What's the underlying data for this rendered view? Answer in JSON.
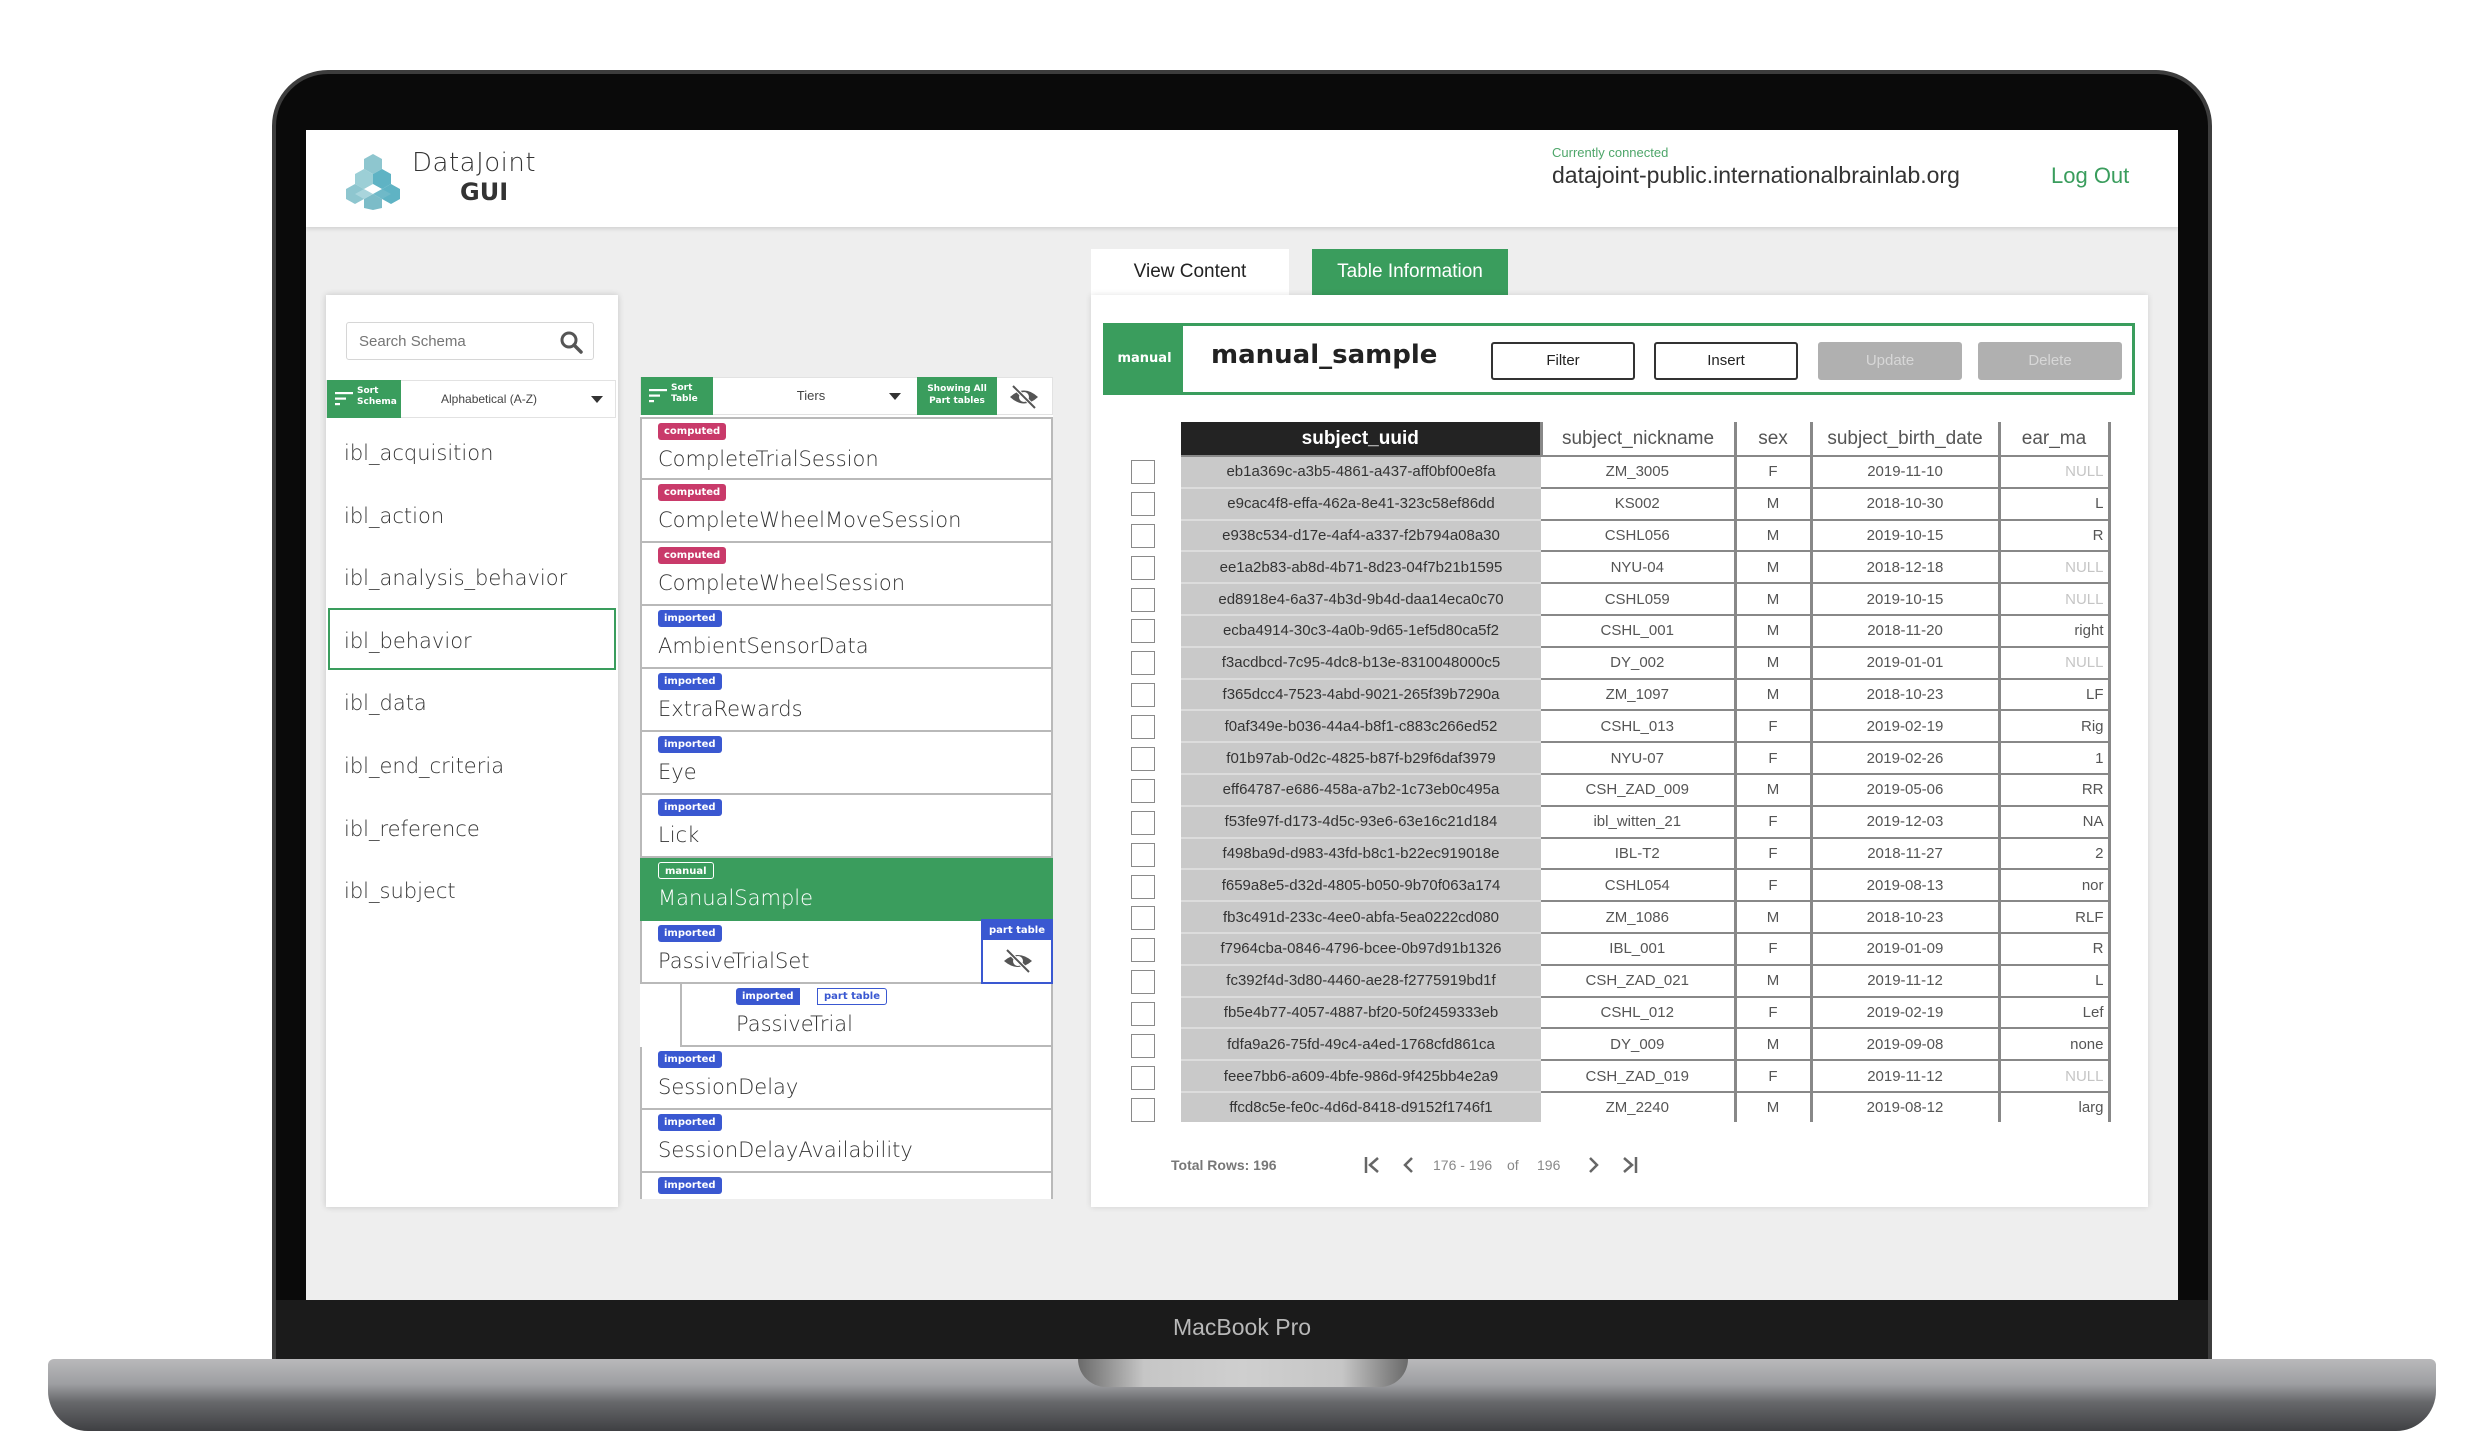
{
  "device": {
    "label": "MacBook Pro"
  },
  "app": {
    "logo_line1": "DataJoint",
    "logo_line2": "GUI",
    "connection_label": "Currently connected",
    "connection_host": "datajoint-public.internationalbrainlab.org",
    "logout_label": "Log Out"
  },
  "colors": {
    "accent": "#3a9d5d",
    "computed": "#c93a6a",
    "imported": "#3a58d1",
    "key_header": "#232323"
  },
  "schema_panel": {
    "search_placeholder": "Search Schema",
    "sort_label_1": "Sort",
    "sort_label_2": "Schema",
    "sort_value": "Alphabetical (A-Z)",
    "selected": "ibl_behavior",
    "items": [
      {
        "label": "ibl_acquisition"
      },
      {
        "label": "ibl_action"
      },
      {
        "label": "ibl_analysis_behavior"
      },
      {
        "label": "ibl_behavior"
      },
      {
        "label": "ibl_data"
      },
      {
        "label": "ibl_end_criteria"
      },
      {
        "label": "ibl_reference"
      },
      {
        "label": "ibl_subject"
      }
    ]
  },
  "tables_panel": {
    "sort_label_1": "Sort",
    "sort_label_2": "Table",
    "sort_value": "Tiers",
    "showing_label_1": "Showing All",
    "showing_label_2": "Part tables",
    "part_table_label": "part table",
    "items": [
      {
        "tier": "computed",
        "name": "CompleteTrialSession"
      },
      {
        "tier": "computed",
        "name": "CompleteWheelMoveSession"
      },
      {
        "tier": "computed",
        "name": "CompleteWheelSession"
      },
      {
        "tier": "imported",
        "name": "AmbientSensorData"
      },
      {
        "tier": "imported",
        "name": "ExtraRewards"
      },
      {
        "tier": "imported",
        "name": "Eye"
      },
      {
        "tier": "imported",
        "name": "Lick"
      },
      {
        "tier": "manual",
        "name": "ManualSample",
        "selected": true
      },
      {
        "tier": "imported",
        "name": "PassiveTrialSet",
        "has_part": true
      },
      {
        "tier": "imported",
        "name": "PassiveTrial",
        "is_part": true,
        "part_label": "part table"
      },
      {
        "tier": "imported",
        "name": "SessionDelay"
      },
      {
        "tier": "imported",
        "name": "SessionDelayAvailability"
      },
      {
        "tier": "imported",
        "name": ""
      }
    ]
  },
  "content": {
    "tabs": [
      {
        "label": "View Content"
      },
      {
        "label": "Table Information"
      }
    ],
    "tier": "manual",
    "table_name": "manual_sample",
    "buttons": {
      "filter": "Filter",
      "insert": "Insert",
      "update": "Update",
      "delete": "Delete"
    },
    "columns": [
      "subject_uuid",
      "subject_nickname",
      "sex",
      "subject_birth_date",
      "ear_ma"
    ],
    "rows": [
      [
        "eb1a369c-a3b5-4861-a437-aff0bf00e8fa",
        "ZM_3005",
        "F",
        "2019-11-10",
        "NULL"
      ],
      [
        "e9cac4f8-effa-462a-8e41-323c58ef86dd",
        "KS002",
        "M",
        "2018-10-30",
        "L"
      ],
      [
        "e938c534-d17e-4af4-a337-f2b794a08a30",
        "CSHL056",
        "M",
        "2019-10-15",
        "R"
      ],
      [
        "ee1a2b83-ab8d-4b71-8d23-04f7b21b1595",
        "NYU-04",
        "M",
        "2018-12-18",
        "NULL"
      ],
      [
        "ed8918e4-6a37-4b3d-9b4d-daa14eca0c70",
        "CSHL059",
        "M",
        "2019-10-15",
        "NULL"
      ],
      [
        "ecba4914-30c3-4a0b-9d65-1ef5d80ca5f2",
        "CSHL_001",
        "M",
        "2018-11-20",
        "right"
      ],
      [
        "f3acdbcd-7c95-4dc8-b13e-8310048000c5",
        "DY_002",
        "M",
        "2019-01-01",
        "NULL"
      ],
      [
        "f365dcc4-7523-4abd-9021-265f39b7290a",
        "ZM_1097",
        "M",
        "2018-10-23",
        "LF"
      ],
      [
        "f0af349e-b036-44a4-b8f1-c883c266ed52",
        "CSHL_013",
        "F",
        "2019-02-19",
        "Rig"
      ],
      [
        "f01b97ab-0d2c-4825-b87f-b29f6daf3979",
        "NYU-07",
        "F",
        "2019-02-26",
        "1"
      ],
      [
        "eff64787-e686-458a-a7b2-1c73eb0c495a",
        "CSH_ZAD_009",
        "M",
        "2019-05-06",
        "RR"
      ],
      [
        "f53fe97f-d173-4d5c-93e6-63e16c21d184",
        "ibl_witten_21",
        "F",
        "2019-12-03",
        "NA"
      ],
      [
        "f498ba9d-d983-43fd-b8c1-b22ec919018e",
        "IBL-T2",
        "F",
        "2018-11-27",
        "2"
      ],
      [
        "f659a8e5-d32d-4805-b050-9b70f063a174",
        "CSHL054",
        "F",
        "2019-08-13",
        "nor"
      ],
      [
        "fb3c491d-233c-4ee0-abfa-5ea0222cd080",
        "ZM_1086",
        "M",
        "2018-10-23",
        "RLF"
      ],
      [
        "f7964cba-0846-4796-bcee-0b97d91b1326",
        "IBL_001",
        "F",
        "2019-01-09",
        "R"
      ],
      [
        "fc392f4d-3d80-4460-ae28-f2775919bd1f",
        "CSH_ZAD_021",
        "M",
        "2019-11-12",
        "L"
      ],
      [
        "fb5e4b77-4057-4887-bf20-50f2459333eb",
        "CSHL_012",
        "F",
        "2019-02-19",
        "Lef"
      ],
      [
        "fdfa9a26-75fd-49c4-a4ed-1768cfd861ca",
        "DY_009",
        "M",
        "2019-09-08",
        "none"
      ],
      [
        "feee7bb6-a609-4bfe-986d-9f425bb4e2a9",
        "CSH_ZAD_019",
        "F",
        "2019-11-12",
        "NULL"
      ],
      [
        "ffcd8c5e-fe0c-4d6d-8418-d9152f1746f1",
        "ZM_2240",
        "M",
        "2019-08-12",
        "larg"
      ]
    ],
    "footer": {
      "total_rows_label": "Total Rows: 196",
      "range": "176 - 196",
      "of": "of",
      "total": "196"
    }
  }
}
